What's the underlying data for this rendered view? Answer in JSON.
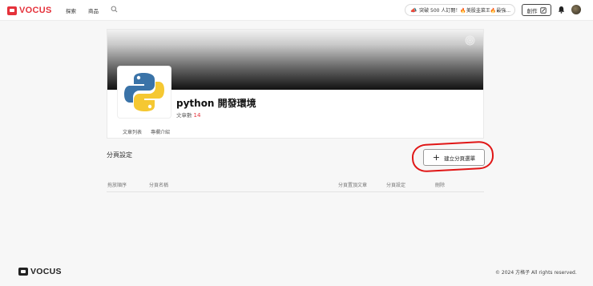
{
  "brand": {
    "name": "VOCUS",
    "accent": "#e5323b"
  },
  "nav": {
    "explore": "探索",
    "shop": "商品",
    "promo_text": "突破 500 人訂閱！🔥美股韭菜王🔥最強...",
    "create_label": "創作"
  },
  "column": {
    "title": "python 開發環境",
    "count_label": "文章數",
    "count_value": "14",
    "tabs": [
      "文章列表",
      "專欄介紹"
    ]
  },
  "section": {
    "title": "分頁設定",
    "add_button": "建立分頁選單",
    "columns": [
      "拖放順序",
      "分頁名稱",
      "分頁置頂文章",
      "分頁設定",
      "刪除"
    ]
  },
  "footer": {
    "brand": "VOCUS",
    "copyright": "© 2024 方格子 All rights reserved."
  },
  "icons": [
    "search-icon",
    "edit-icon",
    "bell-icon",
    "gear-icon",
    "python-logo",
    "plus-icon"
  ]
}
